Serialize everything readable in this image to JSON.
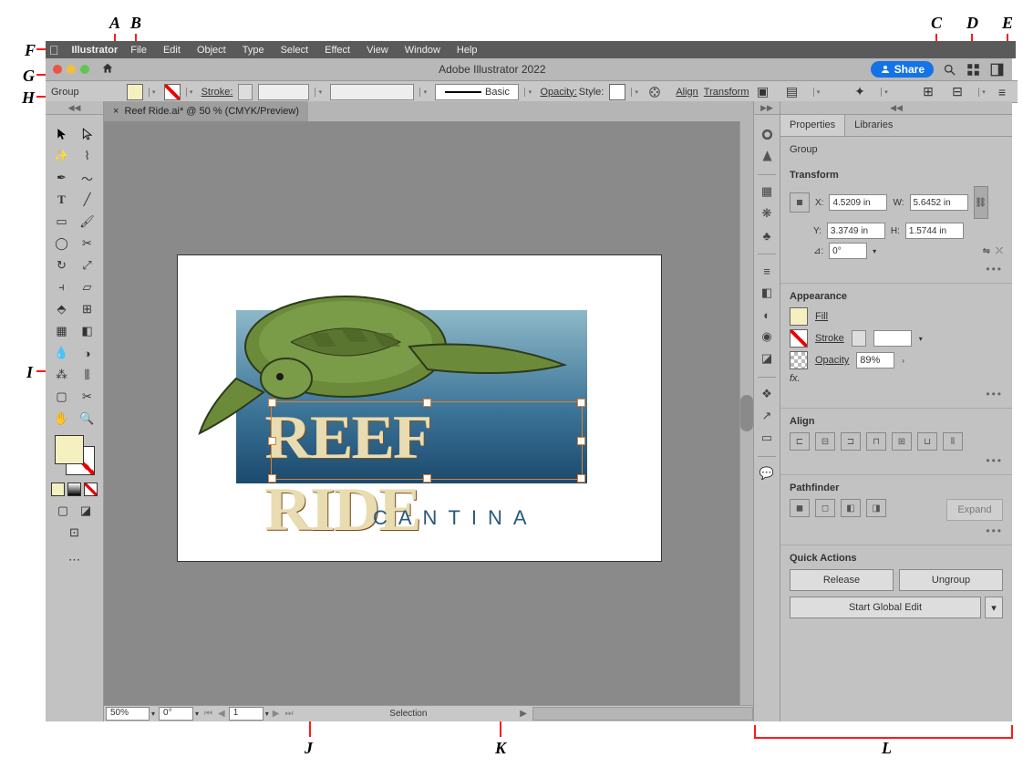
{
  "callouts": {
    "A": "A",
    "B": "B",
    "C": "C",
    "D": "D",
    "E": "E",
    "F": "F",
    "G": "G",
    "H": "H",
    "I": "I",
    "J": "J",
    "K": "K",
    "L": "L"
  },
  "menubar": {
    "app": "Illustrator",
    "items": [
      "File",
      "Edit",
      "Object",
      "Type",
      "Select",
      "Effect",
      "View",
      "Window",
      "Help"
    ]
  },
  "appbar": {
    "title": "Adobe Illustrator 2022",
    "share": "Share"
  },
  "control": {
    "selection": "Group",
    "stroke_label": "Stroke:",
    "brush": "Basic",
    "opacity_label": "Opacity:",
    "style_label": "Style:",
    "align_label": "Align",
    "transform_label": "Transform"
  },
  "document": {
    "tab": "Reef Ride.ai* @ 50 % (CMYK/Preview)",
    "zoom": "50%",
    "artboard_rotate": "0°",
    "artboard_nav": "1",
    "status": "Selection"
  },
  "artwork": {
    "title": "REEF RIDE",
    "subtitle": "CANTINA"
  },
  "panels": {
    "properties_tab": "Properties",
    "libraries_tab": "Libraries",
    "selection_type": "Group",
    "transform": {
      "title": "Transform",
      "x_label": "X:",
      "x": "4.5209 in",
      "y_label": "Y:",
      "y": "3.3749 in",
      "w_label": "W:",
      "w": "5.6452 in",
      "h_label": "H:",
      "h": "1.5744 in",
      "angle_label": "⊿:",
      "angle": "0°"
    },
    "appearance": {
      "title": "Appearance",
      "fill": "Fill",
      "stroke": "Stroke",
      "opacity": "Opacity",
      "opacity_value": "89%",
      "fx": "fx."
    },
    "align": {
      "title": "Align"
    },
    "pathfinder": {
      "title": "Pathfinder",
      "expand": "Expand"
    },
    "quick_actions": {
      "title": "Quick Actions",
      "release": "Release",
      "ungroup": "Ungroup",
      "global_edit": "Start Global Edit"
    }
  },
  "colors": {
    "fill": "#f5f0c0",
    "red": "#eb5545",
    "yellow": "#f5bd3f",
    "green": "#61c554"
  }
}
